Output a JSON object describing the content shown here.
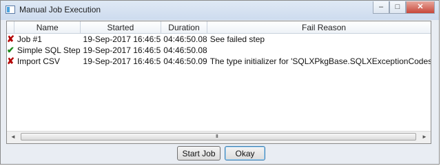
{
  "window": {
    "title": "Manual Job Execution"
  },
  "window_controls": {
    "minimize": "–",
    "maximize": "□",
    "close": "✕"
  },
  "table": {
    "columns": [
      "",
      "Name",
      "Started",
      "Duration",
      "Fail Reason"
    ],
    "rows": [
      {
        "status": "failed-x-icon",
        "name": "Job #1",
        "started": "19-Sep-2017 16:46:5",
        "duration": "04:46:50.08",
        "fail_reason": "See failed step"
      },
      {
        "status": "success-check-icon",
        "name": "Simple SQL Step",
        "started": "19-Sep-2017 16:46:5",
        "duration": "04:46:50.08",
        "fail_reason": ""
      },
      {
        "status": "failed-x-icon",
        "name": "Import CSV",
        "started": "19-Sep-2017 16:46:5",
        "duration": "04:46:50.09",
        "fail_reason": "The type initializer for 'SQLXPkgBase.SQLXExceptionCodes'..."
      }
    ]
  },
  "scrollbar": {
    "left_arrow": "◄",
    "right_arrow": "►",
    "grip": "III"
  },
  "buttons": {
    "start_job": "Start Job",
    "okay": "Okay"
  },
  "colors": {
    "failed": "#b30000",
    "success": "#1a8a1a",
    "accent": "#3c7fb1"
  }
}
